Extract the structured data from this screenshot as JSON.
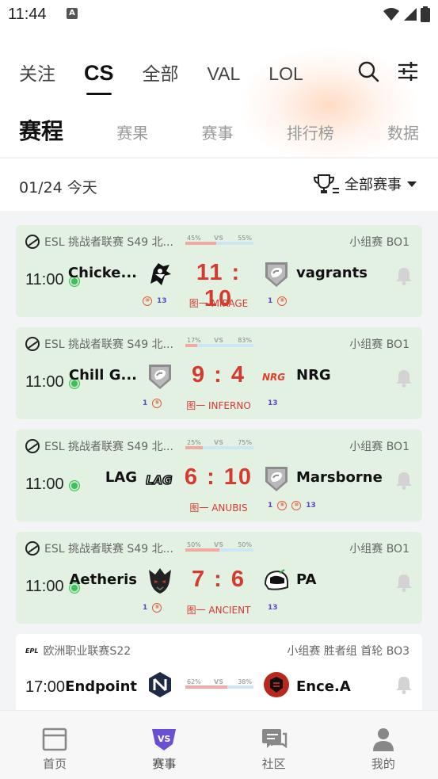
{
  "status": {
    "time": "11:44",
    "app_icon_text": "A"
  },
  "game_tabs": [
    "关注",
    "CS",
    "全部",
    "VAL",
    "LOL"
  ],
  "active_game_tab": "CS",
  "sub_tabs": [
    "赛程",
    "赛果",
    "赛事",
    "排行榜",
    "数据"
  ],
  "date": {
    "text": "01/24 今天"
  },
  "filter": {
    "label": "全部赛事"
  },
  "matches": [
    {
      "league": "ESL 挑战者联赛 S49 北...",
      "stage": "小组赛 BO1",
      "time": "11:00",
      "team1": "Chicke...",
      "team2": "vagrants",
      "score": "11 : 10",
      "map": "图一 MIRAGE",
      "vote_left": "45%",
      "vote_right": "55%",
      "vote_left_frac": 0.45,
      "vs": "VS",
      "tags_left": [
        "⑩",
        "13"
      ],
      "tags_right": [
        "1",
        "⑤"
      ],
      "live": true
    },
    {
      "league": "ESL 挑战者联赛 S49 北...",
      "stage": "小组赛 BO1",
      "time": "11:00",
      "team1": "Chill G...",
      "team2": "NRG",
      "score": "9 : 4",
      "map": "图一 INFERNO",
      "vote_left": "17%",
      "vote_right": "83%",
      "vote_left_frac": 0.17,
      "vs": "VS",
      "tags_left": [
        "1",
        "⑤"
      ],
      "tags_right": [
        "13"
      ],
      "live": true
    },
    {
      "league": "ESL 挑战者联赛 S49 北...",
      "stage": "小组赛 BO1",
      "time": "11:00",
      "team1": "LAG",
      "team2": "Marsborne",
      "score": "6 : 10",
      "map": "图一 ANUBIS",
      "vote_left": "25%",
      "vote_right": "75%",
      "vote_left_frac": 0.25,
      "vs": "VS",
      "tags_left": [],
      "tags_right": [
        "1",
        "⑤",
        "⑩",
        "13"
      ],
      "live": true
    },
    {
      "league": "ESL 挑战者联赛 S49 北...",
      "stage": "小组赛 BO1",
      "time": "11:00",
      "team1": "Aetheris",
      "team2": "PA",
      "score": "7 : 6",
      "map": "图一 ANCIENT",
      "vote_left": "50%",
      "vote_right": "50%",
      "vote_left_frac": 0.5,
      "vs": "VS",
      "tags_left": [
        "1",
        "⑤"
      ],
      "tags_right": [
        "13"
      ],
      "live": true
    },
    {
      "league": "欧洲职业联赛S22",
      "league_logo_text": "EPL",
      "stage": "小组赛 胜者组 首轮 BO3",
      "time": "17:00",
      "team1": "Endpoint",
      "team2": "Ence.A",
      "vote_left": "62%",
      "vote_right": "38%",
      "vote_left_frac": 0.62,
      "vs": "VS",
      "live": false
    }
  ],
  "team_logo_text": {
    "nrg": "NRG",
    "lag": "LAG"
  },
  "bottom_nav": [
    {
      "label": "首页",
      "icon": "home-icon"
    },
    {
      "label": "赛事",
      "icon": "vs-icon"
    },
    {
      "label": "社区",
      "icon": "community-icon"
    },
    {
      "label": "我的",
      "icon": "profile-icon"
    }
  ],
  "colors": {
    "live_card": "#e3f1e3",
    "score": "#d63a2f",
    "live_dot": "#3fc05a",
    "active_tab_icon": "#6a4fd3"
  }
}
